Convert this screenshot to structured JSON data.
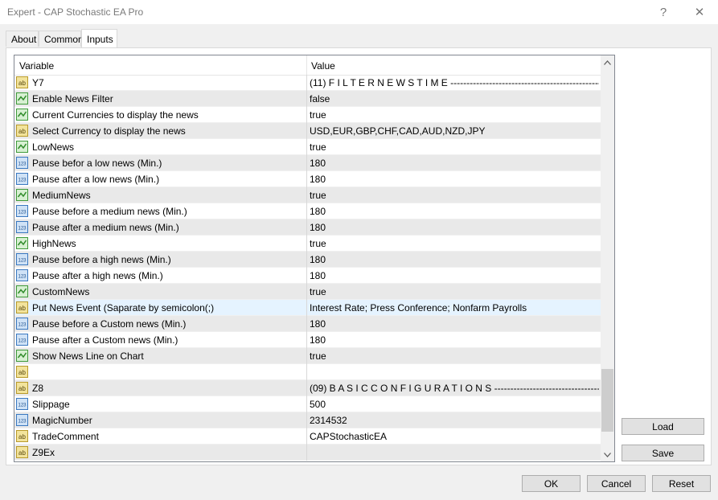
{
  "window": {
    "title": "Expert - CAP Stochastic EA Pro",
    "help": "?",
    "close": "✕"
  },
  "tabs": [
    {
      "label": "About"
    },
    {
      "label": "Common"
    },
    {
      "label": "Inputs",
      "active": true
    }
  ],
  "grid": {
    "col_variable": "Variable",
    "col_value": "Value",
    "rows": [
      {
        "type": "ab",
        "variable": "Y7",
        "value": "(11)  F I L T E R  N E W S  T I M E ------------------------------------------------------..."
      },
      {
        "type": "bool",
        "variable": "Enable News Filter",
        "value": "false"
      },
      {
        "type": "bool",
        "variable": "Current Currencies to display the news",
        "value": "true"
      },
      {
        "type": "ab",
        "variable": "Select Currency to display the news",
        "value": "USD,EUR,GBP,CHF,CAD,AUD,NZD,JPY"
      },
      {
        "type": "bool",
        "variable": "LowNews",
        "value": "true"
      },
      {
        "type": "num",
        "variable": "Pause befor a low news (Min.)",
        "value": "180"
      },
      {
        "type": "num",
        "variable": "Pause after a low news (Min.)",
        "value": "180"
      },
      {
        "type": "bool",
        "variable": "MediumNews",
        "value": "true"
      },
      {
        "type": "num",
        "variable": "Pause before a medium news (Min.)",
        "value": "180"
      },
      {
        "type": "num",
        "variable": "Pause after a medium news (Min.)",
        "value": "180"
      },
      {
        "type": "bool",
        "variable": "HighNews",
        "value": "true"
      },
      {
        "type": "num",
        "variable": "Pause before a high news (Min.)",
        "value": "180"
      },
      {
        "type": "num",
        "variable": "Pause after a high news (Min.)",
        "value": "180"
      },
      {
        "type": "bool",
        "variable": "CustomNews",
        "value": "true"
      },
      {
        "type": "ab",
        "variable": "Put News Event (Saparate by semicolon(;)",
        "value": "Interest Rate; Press Conference; Nonfarm Payrolls",
        "selected": true
      },
      {
        "type": "num",
        "variable": "Pause before a Custom news (Min.)",
        "value": "180"
      },
      {
        "type": "num",
        "variable": "Pause after a Custom news (Min.)",
        "value": "180"
      },
      {
        "type": "bool",
        "variable": "Show News Line on Chart",
        "value": "true"
      },
      {
        "type": "ab",
        "variable": "",
        "value": ""
      },
      {
        "type": "ab",
        "variable": "Z8",
        "value": "(09)  B A S I C   C O N F I G U R A T I O N S --------------------------------------------..."
      },
      {
        "type": "num",
        "variable": "Slippage",
        "value": "500"
      },
      {
        "type": "num",
        "variable": "MagicNumber",
        "value": "2314532"
      },
      {
        "type": "ab",
        "variable": "TradeComment",
        "value": "CAPStochasticEA"
      },
      {
        "type": "ab",
        "variable": "Z9Ex",
        "value": ""
      }
    ],
    "scroll_position": 0.8
  },
  "side_buttons": {
    "load": "Load",
    "save": "Save"
  },
  "footer": {
    "ok": "OK",
    "cancel": "Cancel",
    "reset": "Reset"
  },
  "icons": {
    "ab": "string-type-icon",
    "bool": "bool-type-icon",
    "num": "number-type-icon"
  }
}
